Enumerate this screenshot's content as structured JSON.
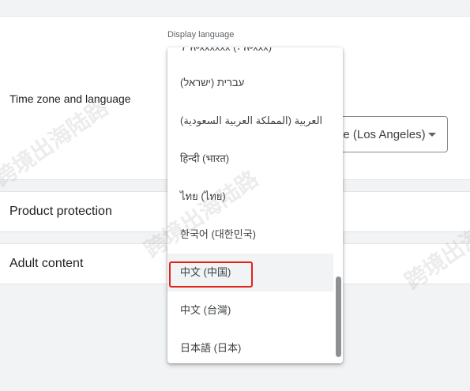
{
  "sections": {
    "time_zone_language": {
      "title": "Time zone and language"
    },
    "product_protection": {
      "title": "Product protection"
    },
    "adult_content": {
      "title": "Adult content"
    }
  },
  "timezone_select": {
    "value": "ne (Los Angeles)"
  },
  "language_select": {
    "label": "Display language",
    "options": [
      "ፕ ሎxxxxxx (፣ ሎxxx)",
      "עברית (ישראל)",
      "العربية (المملكة العربية السعودية)",
      "हिन्दी (भारत)",
      "ไทย (ไทย)",
      "한국어 (대한민국)",
      "中文 (中国)",
      "中文 (台灣)",
      "日本語 (日本)"
    ],
    "selected_index": 6,
    "highlighted_option": "中文 (中国)"
  },
  "watermark": {
    "text": "跨境出海陆路"
  },
  "colors": {
    "highlight_border": "#e2231a",
    "scrollbar": "#8e9194"
  }
}
